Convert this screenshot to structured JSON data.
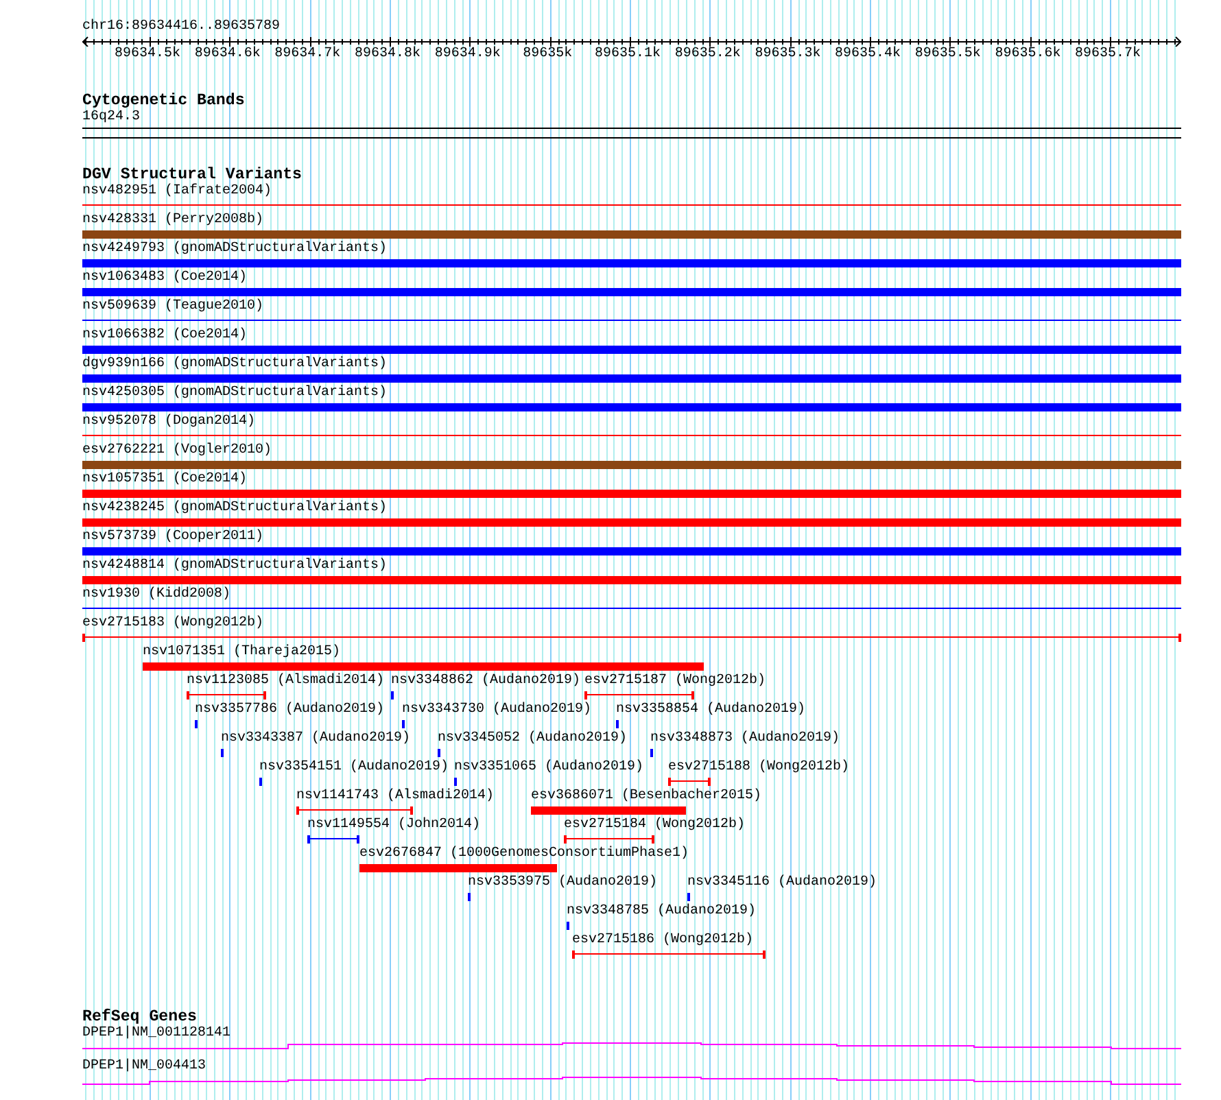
{
  "location": "chr16:89634416..89635789",
  "ruler": {
    "labels": [
      "89634.5k",
      "89634.6k",
      "89634.7k",
      "89634.8k",
      "89634.9k",
      "89635k",
      "89635.1k",
      "89635.2k",
      "89635.3k",
      "89635.4k",
      "89635.5k",
      "89635.6k",
      "89635.7k"
    ]
  },
  "tracks": [
    {
      "kind": "cytoband",
      "title": "Cytogenetic Bands",
      "bands": [
        {
          "label": "16q24.3"
        }
      ]
    },
    {
      "kind": "variants",
      "title": "DGV Structural Variants",
      "rows": [
        [
          {
            "label": "nsv482951 (Iafrate2004)",
            "kind": "line",
            "color": "#ff0000"
          }
        ],
        [
          {
            "label": "nsv428331 (Perry2008b)",
            "kind": "bar",
            "color": "#8b4513"
          }
        ],
        [
          {
            "label": "nsv4249793 (gnomADStructuralVariants)",
            "kind": "bar",
            "color": "#0000ff"
          }
        ],
        [
          {
            "label": "nsv1063483 (Coe2014)",
            "kind": "bar",
            "color": "#0000ff"
          }
        ],
        [
          {
            "label": "nsv509639 (Teague2010)",
            "kind": "line",
            "color": "#0000ff"
          }
        ],
        [
          {
            "label": "nsv1066382 (Coe2014)",
            "kind": "bar",
            "color": "#0000ff"
          }
        ],
        [
          {
            "label": "dgv939n166 (gnomADStructuralVariants)",
            "kind": "bar",
            "color": "#0000ff"
          }
        ],
        [
          {
            "label": "nsv4250305 (gnomADStructuralVariants)",
            "kind": "bar",
            "color": "#0000ff"
          }
        ],
        [
          {
            "label": "nsv952078 (Dogan2014)",
            "kind": "line",
            "color": "#ff0000"
          }
        ],
        [
          {
            "label": "esv2762221 (Vogler2010)",
            "kind": "bar",
            "color": "#8b4513"
          }
        ],
        [
          {
            "label": "nsv1057351 (Coe2014)",
            "kind": "bar",
            "color": "#ff0000"
          }
        ],
        [
          {
            "label": "nsv4238245 (gnomADStructuralVariants)",
            "kind": "bar",
            "color": "#ff0000"
          }
        ],
        [
          {
            "label": "nsv573739 (Cooper2011)",
            "kind": "bar",
            "color": "#0000ff"
          }
        ],
        [
          {
            "label": "nsv4248814 (gnomADStructuralVariants)",
            "kind": "bar",
            "color": "#ff0000"
          }
        ],
        [
          {
            "label": "nsv1930 (Kidd2008)",
            "kind": "line",
            "color": "#0000ff"
          }
        ],
        [
          {
            "label": "esv2715183 (Wong2012b)",
            "kind": "span",
            "color": "#ff0000"
          }
        ],
        [
          {
            "label": "nsv1071351 (Thareja2015)",
            "kind": "bar",
            "color": "#ff0000"
          }
        ],
        [
          {
            "label": "nsv1123085 (Alsmadi2014)",
            "kind": "span",
            "color": "#ff0000"
          },
          {
            "label": "nsv3348862 (Audano2019)",
            "kind": "bar",
            "color": "#0000ff"
          },
          {
            "label": "esv2715187 (Wong2012b)",
            "kind": "span",
            "color": "#ff0000"
          }
        ],
        [
          {
            "label": "nsv3357786 (Audano2019)",
            "kind": "bar",
            "color": "#0000ff"
          },
          {
            "label": "nsv3343730 (Audano2019)",
            "kind": "bar",
            "color": "#0000ff"
          },
          {
            "label": "nsv3358854 (Audano2019)",
            "kind": "bar",
            "color": "#0000ff"
          }
        ],
        [
          {
            "label": "nsv3343387 (Audano2019)",
            "kind": "bar",
            "color": "#0000ff"
          },
          {
            "label": "nsv3345052 (Audano2019)",
            "kind": "bar",
            "color": "#0000ff"
          },
          {
            "label": "nsv3348873 (Audano2019)",
            "kind": "bar",
            "color": "#0000ff"
          }
        ],
        [
          {
            "label": "nsv3354151 (Audano2019)",
            "kind": "bar",
            "color": "#0000ff"
          },
          {
            "label": "nsv3351065 (Audano2019)",
            "kind": "bar",
            "color": "#0000ff"
          },
          {
            "label": "esv2715188 (Wong2012b)",
            "kind": "span",
            "color": "#ff0000"
          }
        ],
        [
          {
            "label": "nsv1141743 (Alsmadi2014)",
            "kind": "span",
            "color": "#ff0000"
          },
          {
            "label": "esv3686071 (Besenbacher2015)",
            "kind": "bar",
            "color": "#ff0000"
          }
        ],
        [
          {
            "label": "nsv1149554 (John2014)",
            "kind": "span",
            "color": "#0000ff"
          },
          {
            "label": "esv2715184 (Wong2012b)",
            "kind": "span",
            "color": "#ff0000"
          }
        ],
        [
          {
            "label": "esv2676847 (1000GenomesConsortiumPhase1)",
            "kind": "bar",
            "color": "#ff0000"
          }
        ],
        [
          {
            "label": "nsv3353975 (Audano2019)",
            "kind": "bar",
            "color": "#0000ff"
          },
          {
            "label": "nsv3345116 (Audano2019)",
            "kind": "bar",
            "color": "#0000ff"
          }
        ],
        [
          {
            "label": "nsv3348785 (Audano2019)",
            "kind": "bar",
            "color": "#0000ff"
          }
        ],
        [
          {
            "label": "esv2715186 (Wong2012b)",
            "kind": "span",
            "color": "#ff0000"
          }
        ]
      ]
    },
    {
      "kind": "genes",
      "title": "RefSeq Genes",
      "genes": [
        {
          "label": "DPEP1|NM_001128141"
        },
        {
          "label": "DPEP1|NM_004413"
        }
      ]
    }
  ]
}
